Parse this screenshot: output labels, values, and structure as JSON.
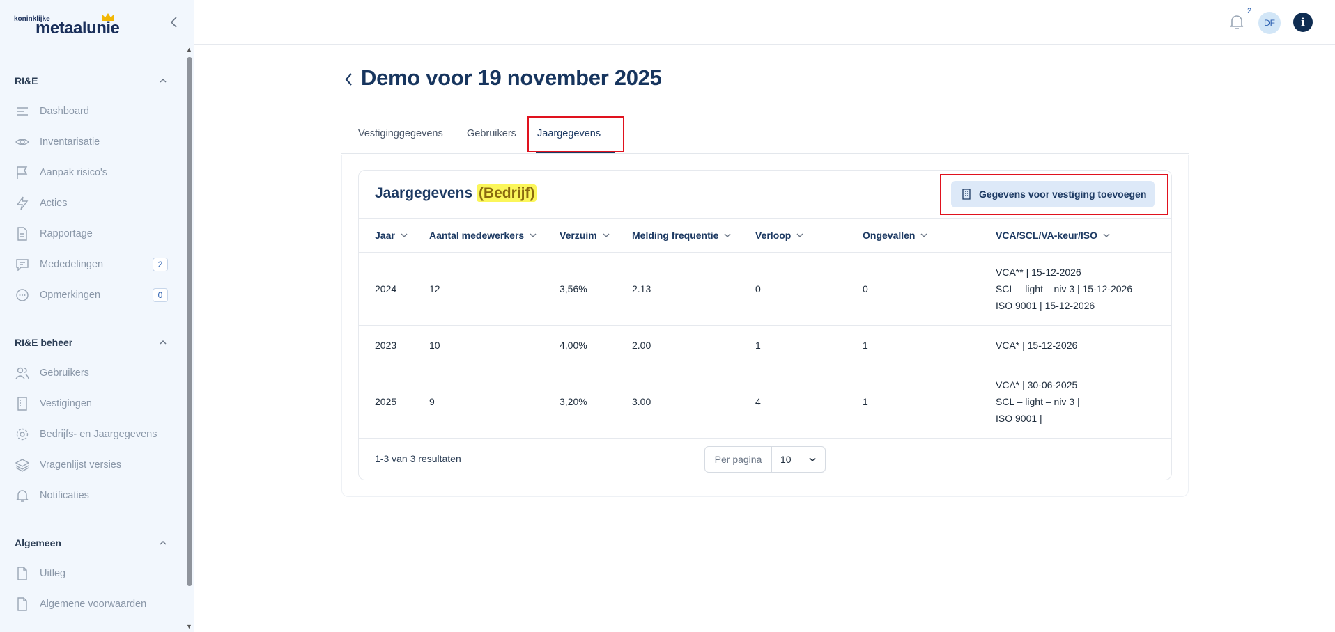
{
  "logo": {
    "small": "koninklijke",
    "big": "metaalunie"
  },
  "sidebar": {
    "sections": [
      {
        "title": "RI&E",
        "items": [
          {
            "label": "Dashboard",
            "icon": "dashboard-icon"
          },
          {
            "label": "Inventarisatie",
            "icon": "eye-icon"
          },
          {
            "label": "Aanpak risico's",
            "icon": "flag-icon"
          },
          {
            "label": "Acties",
            "icon": "lightning-icon"
          },
          {
            "label": "Rapportage",
            "icon": "document-icon"
          },
          {
            "label": "Mededelingen",
            "icon": "message-icon",
            "badge": "2"
          },
          {
            "label": "Opmerkingen",
            "icon": "comment-dots-icon",
            "badge": "0"
          }
        ]
      },
      {
        "title": "RI&E beheer",
        "items": [
          {
            "label": "Gebruikers",
            "icon": "users-icon"
          },
          {
            "label": "Vestigingen",
            "icon": "building-icon"
          },
          {
            "label": "Bedrijfs- en Jaargegevens",
            "icon": "gear-icon"
          },
          {
            "label": "Vragenlijst versies",
            "icon": "layers-icon"
          },
          {
            "label": "Notificaties",
            "icon": "bell-icon"
          }
        ]
      },
      {
        "title": "Algemeen",
        "items": [
          {
            "label": "Uitleg",
            "icon": "file-icon"
          },
          {
            "label": "Algemene voorwaarden",
            "icon": "file-icon"
          }
        ]
      }
    ]
  },
  "topbar": {
    "notification_count": "2",
    "avatar_initials": "DF",
    "info_label": "i"
  },
  "page": {
    "title": "Demo voor 19 november 2025"
  },
  "tabs": [
    {
      "label": "Vestiginggegevens"
    },
    {
      "label": "Gebruikers"
    },
    {
      "label": "Jaargegevens",
      "active": true
    }
  ],
  "card": {
    "title": "Jaargegevens",
    "title_highlight": "(Bedrijf)",
    "add_button": "Gegevens voor vestiging toevoegen",
    "columns": [
      "Jaar",
      "Aantal medewerkers",
      "Verzuim",
      "Melding frequentie",
      "Verloop",
      "Ongevallen",
      "VCA/SCL/VA-keur/ISO"
    ],
    "rows": [
      {
        "jaar": "2024",
        "medewerkers": "12",
        "verzuim": "3,56%",
        "melding": "2.13",
        "verloop": "0",
        "ongevallen": "0",
        "certs": [
          "VCA** | 15-12-2026",
          "SCL – light – niv 3 | 15-12-2026",
          "ISO 9001 | 15-12-2026"
        ]
      },
      {
        "jaar": "2023",
        "medewerkers": "10",
        "verzuim": "4,00%",
        "melding": "2.00",
        "verloop": "1",
        "ongevallen": "1",
        "certs": [
          "VCA* | 15-12-2026"
        ]
      },
      {
        "jaar": "2025",
        "medewerkers": "9",
        "verzuim": "3,20%",
        "melding": "3.00",
        "verloop": "4",
        "ongevallen": "1",
        "certs": [
          "VCA* | 30-06-2025",
          "SCL – light – niv 3 |",
          "ISO 9001 |"
        ]
      }
    ],
    "results_text": "1-3 van 3 resultaten",
    "per_page_label": "Per pagina",
    "per_page_value": "10"
  },
  "colors": {
    "accent": "#1d3a63",
    "highlight_box": "#e0121e",
    "sidebar_bg": "#f2f7fd",
    "title_highlight": "#fbf65a"
  }
}
